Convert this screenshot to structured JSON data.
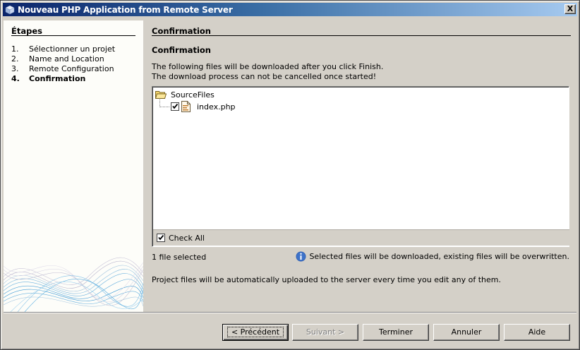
{
  "window": {
    "title": "Nouveau PHP Application from Remote Server",
    "close_glyph": "X"
  },
  "steps": {
    "title": "Étapes",
    "items": [
      {
        "num": "1.",
        "label": "Sélectionner un projet",
        "current": false
      },
      {
        "num": "2.",
        "label": "Name and Location",
        "current": false
      },
      {
        "num": "3.",
        "label": "Remote Configuration",
        "current": false
      },
      {
        "num": "4.",
        "label": "Confirmation",
        "current": true
      }
    ]
  },
  "content": {
    "section_title": "Confirmation",
    "sub_title": "Confirmation",
    "desc_line1": "The following files will be downloaded after you click Finish.",
    "desc_line2": "The download process can not be cancelled once started!",
    "tree": {
      "root_label": "SourceFiles",
      "children": [
        {
          "label": "index.php",
          "checked": true
        }
      ]
    },
    "check_all": {
      "label": "Check All",
      "checked": true
    },
    "selected_count": "1 file selected",
    "info_text": "Selected files will be downloaded, existing files will be overwritten.",
    "upload_note": "Project files will be automatically uploaded to the server every time you edit any of them."
  },
  "buttons": {
    "previous": "< Précédent",
    "next": "Suivant >",
    "finish": "Terminer",
    "cancel": "Annuler",
    "help": "Aide"
  },
  "icons": {
    "window": "netbeans-cube-icon",
    "folder": "folder-open-icon",
    "file": "php-file-icon",
    "info": "info-icon",
    "decoration": "wave-decoration"
  },
  "colors": {
    "titlebar_start": "#0a246a",
    "titlebar_end": "#a6caf0",
    "dialog_bg": "#d4d0c8",
    "panel_bg": "#fdfdf9",
    "info_blue": "#2f5fb3",
    "wave_blue": "#4fa3d9"
  }
}
